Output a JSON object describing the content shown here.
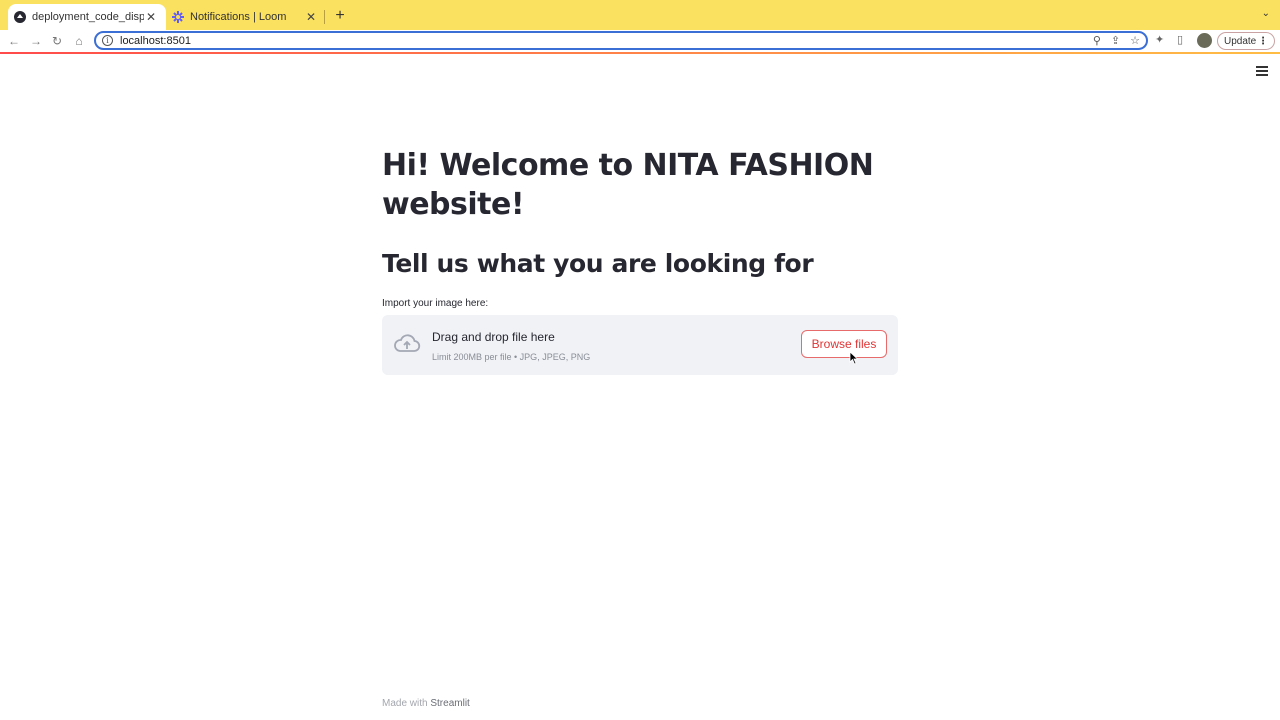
{
  "browser": {
    "tabs": [
      {
        "title": "deployment_code_display · Streamlit",
        "active": true,
        "icon": "streamlit-icon"
      },
      {
        "title": "Notifications | Loom",
        "active": false,
        "icon": "loom-icon"
      }
    ],
    "new_tab": "+",
    "url": "localhost:8501",
    "update_label": "Update",
    "accent_color": "#fbe160"
  },
  "app": {
    "title": "Hi! Welcome to NITA FASHION website!",
    "subtitle": "Tell us what you are looking for",
    "uploader": {
      "label": "Import your image here:",
      "drag_text": "Drag and drop file here",
      "limit_text": "Limit 200MB per file • JPG, JPEG, PNG",
      "button_label": "Browse files",
      "icon": "cloud-upload-icon"
    },
    "footer": {
      "prefix": "Made with",
      "brand": "Streamlit"
    }
  }
}
